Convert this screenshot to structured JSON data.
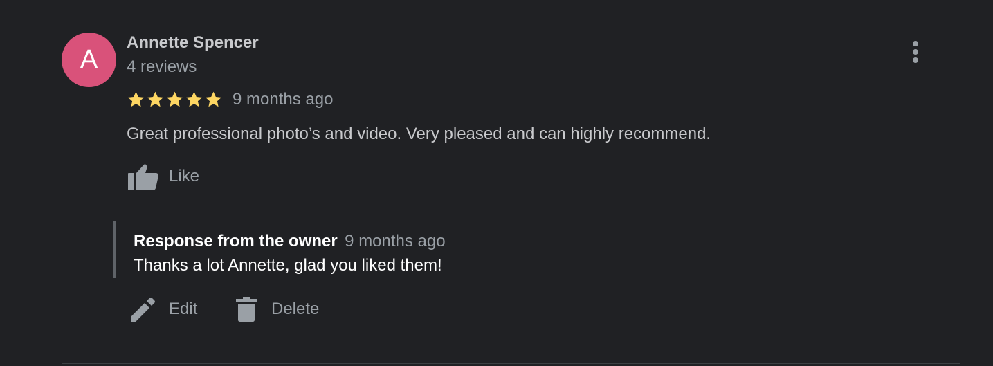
{
  "review": {
    "avatar_letter": "A",
    "avatar_color": "#d9527a",
    "reviewer_name": "Annette Spencer",
    "review_count": "4 reviews",
    "rating": 5,
    "rating_max": 5,
    "star_color": "#fdd663",
    "date": "9 months ago",
    "text": "Great professional photo’s and video. Very pleased and can highly recommend.",
    "like_label": "Like",
    "icons": {
      "more": "more-vert-icon",
      "like": "thumb-up-icon"
    }
  },
  "owner_response": {
    "title": "Response from the owner",
    "date": "9 months ago",
    "text": "Thanks a lot Annette, glad you liked them!"
  },
  "actions": {
    "edit_label": "Edit",
    "delete_label": "Delete",
    "icons": {
      "edit": "pencil-icon",
      "delete": "trash-icon"
    }
  }
}
